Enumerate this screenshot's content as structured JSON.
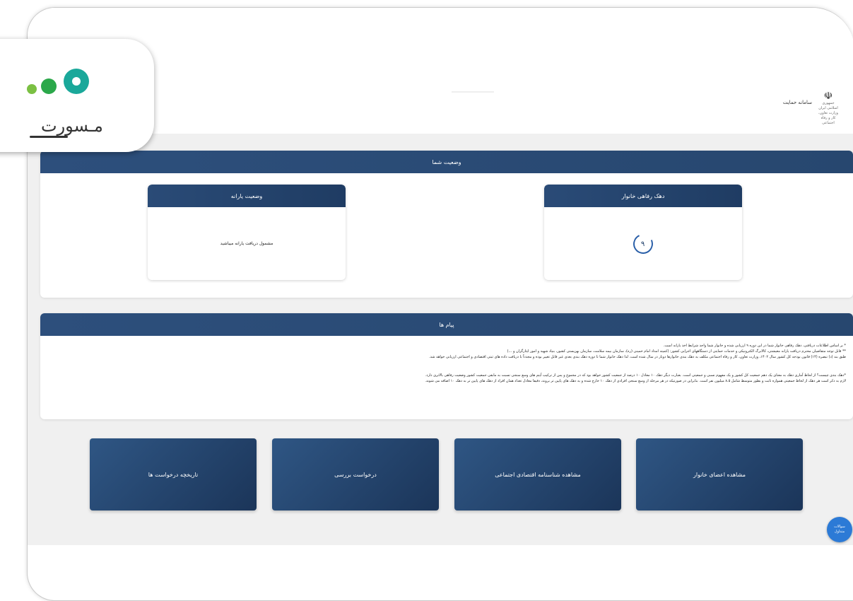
{
  "logo": {
    "word": "مـسورت",
    "colors": {
      "teal": "#1aa89a",
      "green": "#2ba84a",
      "lime": "#7bc043"
    }
  },
  "header": {
    "system_name": "سامانه حمایت",
    "emblem_icon": "iran-emblem-icon",
    "emblem_caption_1": "جمهوری اسلامی ایران",
    "emblem_caption_2": "وزارت تعاون، کار و رفاه اجتماعی"
  },
  "status_section": {
    "title": "وضعیت شما",
    "subsidy_card": {
      "title": "وضعیت یارانه",
      "text": "مشمول دریافت یارانه میباشید"
    },
    "decile_card": {
      "title": "دهک رفاهی خانوار",
      "value": "۹"
    }
  },
  "messages_section": {
    "title": "پیام ها",
    "lines": [
      "* بر اساس اطلاعات دریافتی، دهک رفاهی خانوار شما در این دوره ۹ ارزیابی شده و خانوار شما واجد شرایط اخذ یارانه است.",
      "** قابل توجه متقاضیان محترم دریافت یارانه معیشتی، کالابرگ الکترونیکی و خدمات حمایتی از دستگاههای اجرایی کشور: (کمیته امداد امام خمینی (ره)، سازمان بیمه سلامت، سازمان بهزیستی کشور، بنیاد شهید و امور ایثارگران و ...)",
      "طبق بند (د) تبصره (۱۴) قانون بودجه کل کشور سال ۱۴۰۲، وزارت تعاون، کار و رفاه اجتماعی مکلف به دهک بندی خانوارها دوبار در سال شده است. لذا دهک خانوار شما تا دوره دهک بندی بعدی غیر قابل تغییر بوده و مجدداً با دریافت داده های ثبتی اقتصادی و اجتماعی ارزیابی خواهد شد.",
      "*دهک بندی چیست؟ از لحاظ آماری دهک به معنای یک دهم جمعیت کل کشور و یک مفهوم نسبی و جمعیتی است. بعبارت دیگر دهک ۱۰ معادل ۱۰ درصد از جمعیت کشور خواهد بود که در مجموع و پس از ترکیب آیتم های وسع سنجی نسبت به مابقی جمعیت کشور وضعیت رفاهی بالاتری دارد.",
      "لازم به ذکر است هر دهک از لحاظ جمعیتی همواره ثابت و بطور متوسط شامل ۸.۵ میلیون نفر است. بنابراین در صورتیکه در هر مرحله از وسع سنجی افرادی از دهک ۱۰ خارج شده و به دهک های پایین تر بروند، دقیقا معادل تعداد همان افراد از دهک های پایین تر به دهک ۱۰ اضافه می شوند."
    ]
  },
  "actions": {
    "family_members": "مشاهده اعضای خانوار",
    "economic_id": "مشاهده شناسنامه اقتصادی اجتماعی",
    "review_request": "درخواست بررسی",
    "request_history": "تاریخچه درخواست ها"
  },
  "chat": {
    "label_1": "سوالات",
    "label_2": "متداول"
  }
}
